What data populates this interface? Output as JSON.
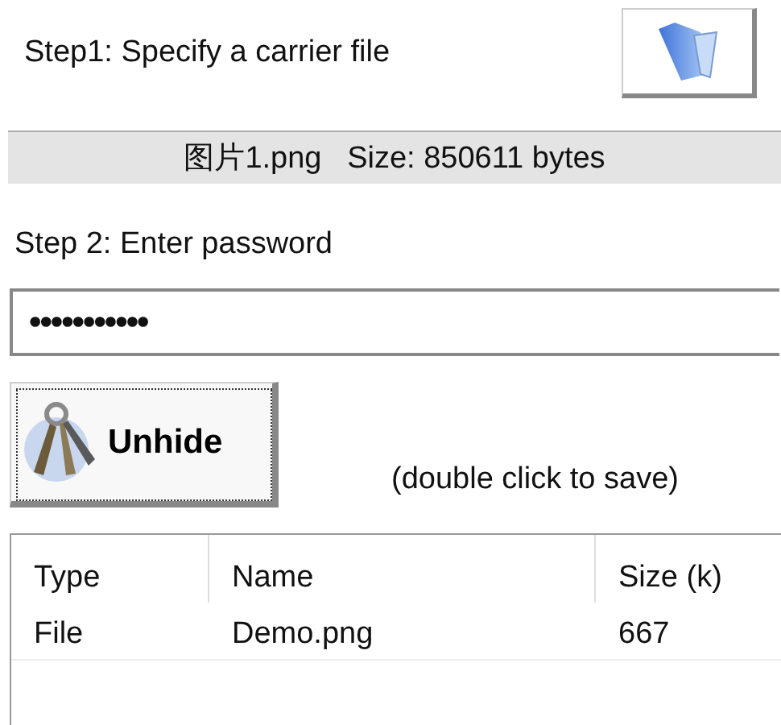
{
  "step1": {
    "label": "Step1: Specify a carrier file"
  },
  "file_info": {
    "text": "图片1.png   Size: 850611 bytes"
  },
  "step2": {
    "label": "Step 2: Enter password",
    "password": {
      "masked_value": "•••••••••••"
    }
  },
  "unhide_button": {
    "label": "Unhide"
  },
  "hint": "(double click to save)",
  "table": {
    "columns": [
      "Type",
      "Name",
      "Size (k)"
    ],
    "rows": [
      [
        "File",
        "Demo.png",
        "667"
      ]
    ]
  }
}
